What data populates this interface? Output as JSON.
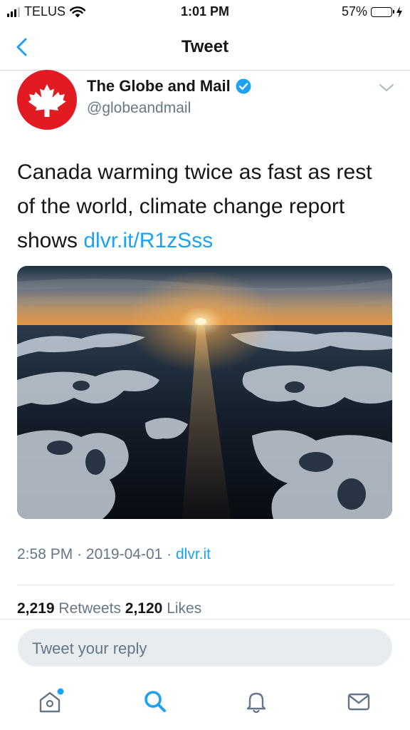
{
  "status_bar": {
    "carrier": "TELUS",
    "time": "1:01 PM",
    "battery": "57%",
    "battery_level": 0.57
  },
  "nav": {
    "title": "Tweet",
    "back_icon": "chevron-left-icon"
  },
  "tweet": {
    "author_name": "The Globe and Mail",
    "author_handle": "@globeandmail",
    "verified": true,
    "text": "Canada warming twice as fast as rest of the world, climate change report shows ",
    "link": "dlvr.it/R1zSss",
    "time": "2:58 PM",
    "date": "2019-04-01",
    "source": "dlvr.it",
    "retweets_count": "2,219",
    "retweets_label": "Retweets",
    "likes_count": "2,120",
    "likes_label": "Likes"
  },
  "reply": {
    "placeholder": "Tweet your reply"
  },
  "tabs": [
    {
      "icon": "home-icon",
      "has_notification_dot": true
    },
    {
      "icon": "search-icon",
      "active": true
    },
    {
      "icon": "bell-icon"
    },
    {
      "icon": "mail-icon"
    }
  ],
  "colors": {
    "accent": "#1da1f2",
    "avatar_bg": "#e21b23",
    "muted": "#657786",
    "battery_fill": "#4cd964"
  }
}
